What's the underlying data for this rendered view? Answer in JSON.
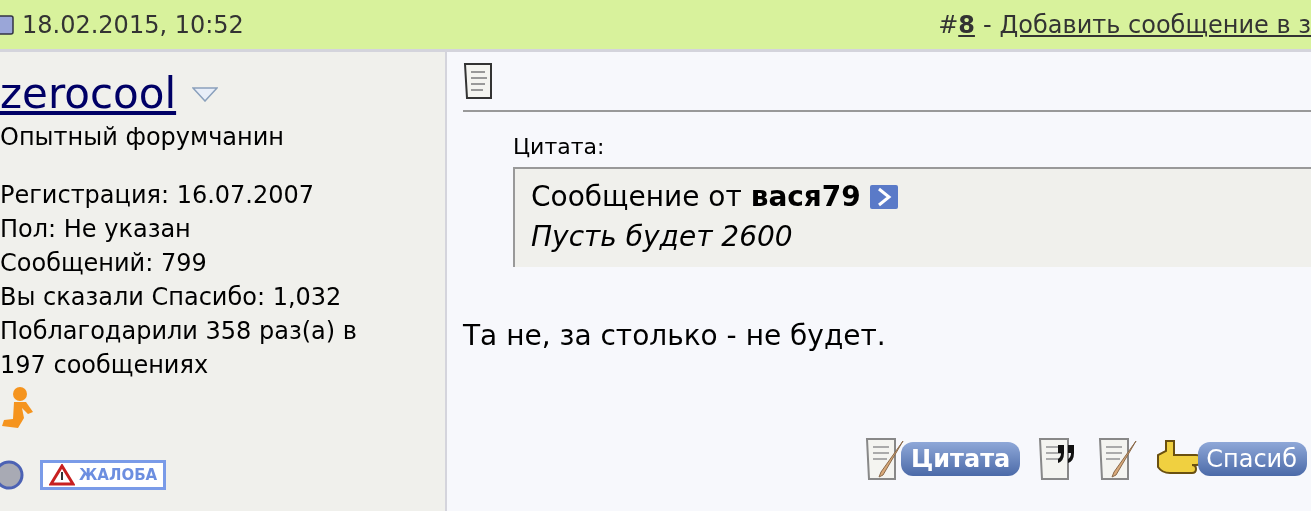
{
  "header": {
    "date": "18.02.2015, 10:52",
    "hash": "#",
    "post_number": "8",
    "separator": "-",
    "link": "Добавить сообщение в з"
  },
  "user": {
    "name": "zerocool",
    "title": "Опытный форумчанин",
    "stats": [
      "Регистрация: 16.07.2007",
      "Пол: Не указан",
      "Сообщений: 799",
      "Вы сказали Спасибо: 1,032",
      "Поблагодарили 358 раз(а) в 197 сообщениях"
    ],
    "report_button": "ЖАЛОБА"
  },
  "post": {
    "quote_label": "Цитата:",
    "quote_from": "Сообщение от",
    "quote_author": "вася79",
    "quote_text": "Пусть будет 2600",
    "message": "Та не, за столько - не будет."
  },
  "buttons": [
    {
      "kind": "quote",
      "label": "Цитата"
    },
    {
      "kind": "multiquote"
    },
    {
      "kind": "edit"
    },
    {
      "kind": "thanks",
      "label": "Спасиб"
    }
  ]
}
